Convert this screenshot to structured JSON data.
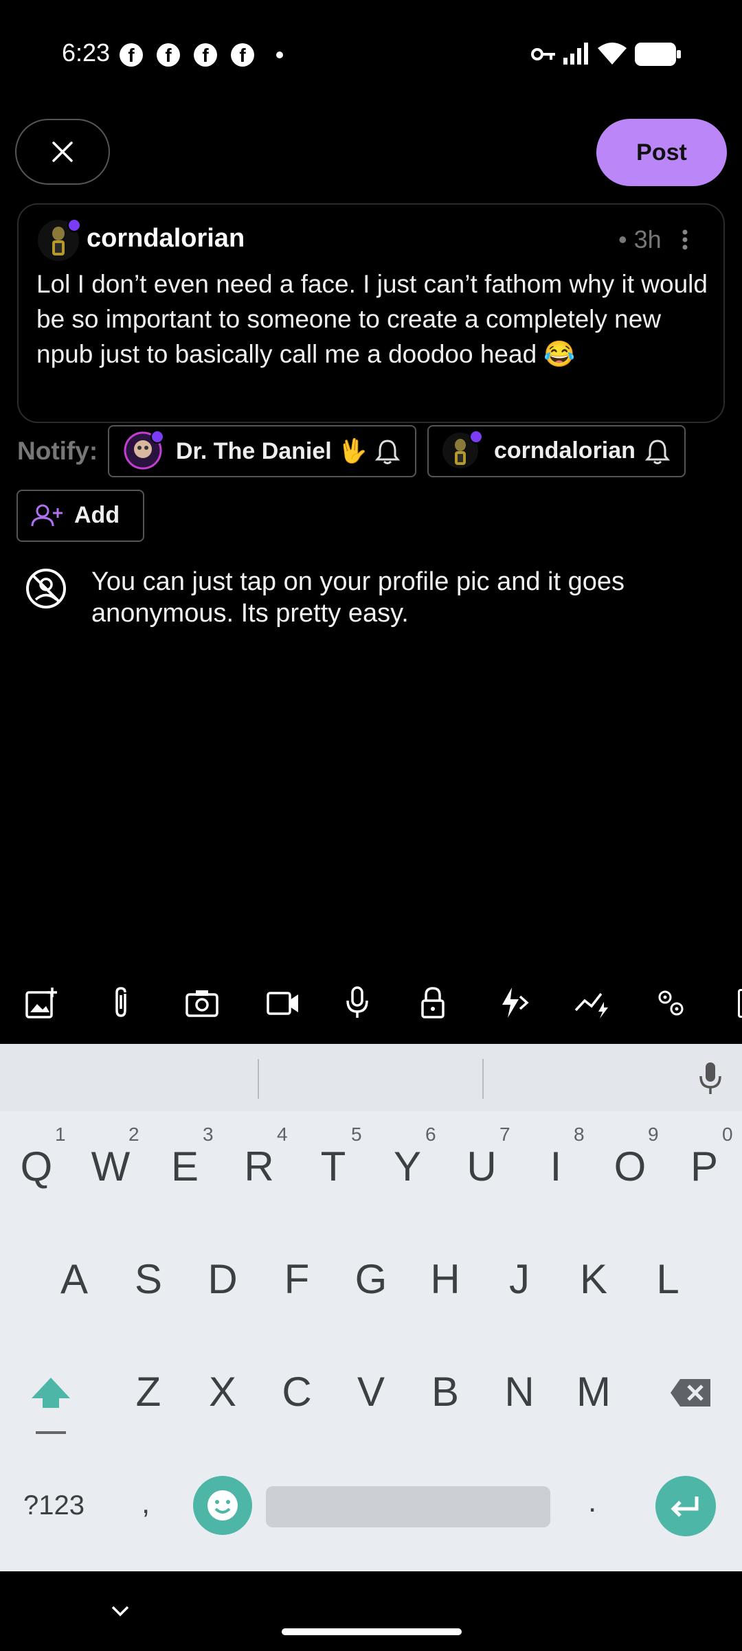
{
  "status_bar": {
    "time": "6:23",
    "notification_icons": [
      "facebook-icon",
      "facebook-icon",
      "facebook-icon",
      "facebook-icon"
    ]
  },
  "header": {
    "post_label": "Post"
  },
  "quoted_note": {
    "author": "corndalorian",
    "time": "• 3h",
    "text": "Lol I don’t even need a face. I just can’t fathom why it would be so important to someone to create a completely new npub just to basically call me a doodoo head 😂"
  },
  "notify": {
    "label": "Notify:",
    "users": [
      {
        "name": "Dr. The Daniel 🖖"
      },
      {
        "name": "corndalorian"
      }
    ],
    "add_label": "Add"
  },
  "reply": {
    "text": "You can just tap on your profile pic and it goes anonymous. Its pretty easy."
  },
  "toolbar": {
    "icons": [
      "add-image-icon",
      "attachment-icon",
      "camera-icon",
      "video-icon",
      "microphone-icon",
      "lock-icon",
      "zap-icon",
      "poll-icon",
      "settings-icon"
    ]
  },
  "keyboard": {
    "row1": [
      "Q",
      "W",
      "E",
      "R",
      "T",
      "Y",
      "U",
      "I",
      "O",
      "P"
    ],
    "row1_hints": [
      "1",
      "2",
      "3",
      "4",
      "5",
      "6",
      "7",
      "8",
      "9",
      "0"
    ],
    "row2": [
      "A",
      "S",
      "D",
      "F",
      "G",
      "H",
      "J",
      "K",
      "L"
    ],
    "row3": [
      "Z",
      "X",
      "C",
      "V",
      "B",
      "N",
      "M"
    ],
    "symbols_label": "?123",
    "comma": ",",
    "period": "."
  },
  "colors": {
    "accent": "#bb86f7",
    "keyboard_bg": "#e9edf1",
    "teal": "#4db6a6"
  }
}
